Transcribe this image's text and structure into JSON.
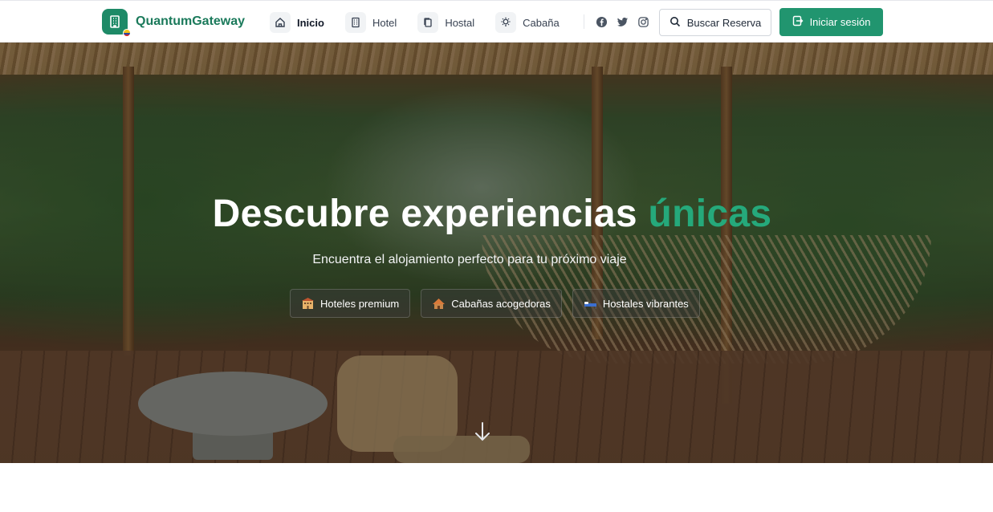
{
  "brand": {
    "name": "QuantumGateway",
    "icon": "building-icon",
    "accent_color": "#21956f"
  },
  "nav": {
    "items": [
      {
        "label": "Inicio",
        "icon": "home-icon",
        "active": true
      },
      {
        "label": "Hotel",
        "icon": "building-icon",
        "active": false
      },
      {
        "label": "Hostal",
        "icon": "copy-icon",
        "active": false
      },
      {
        "label": "Cabaña",
        "icon": "lightbulb-icon",
        "active": false
      }
    ]
  },
  "social": [
    "facebook-icon",
    "twitter-icon",
    "instagram-icon"
  ],
  "actions": {
    "search_label": "Buscar Reserva",
    "login_label": "Iniciar sesión"
  },
  "hero": {
    "title_main": "Descubre experiencias",
    "title_accent": "únicas",
    "subtitle": "Encuentra el alojamiento perfecto para tu próximo viaje",
    "chips": [
      {
        "label": "Hoteles premium",
        "icon": "hotel-emoji"
      },
      {
        "label": "Cabañas acogedoras",
        "icon": "hut-emoji"
      },
      {
        "label": "Hostales vibrantes",
        "icon": "bed-emoji"
      }
    ],
    "scroll_icon": "arrow-down-icon"
  }
}
